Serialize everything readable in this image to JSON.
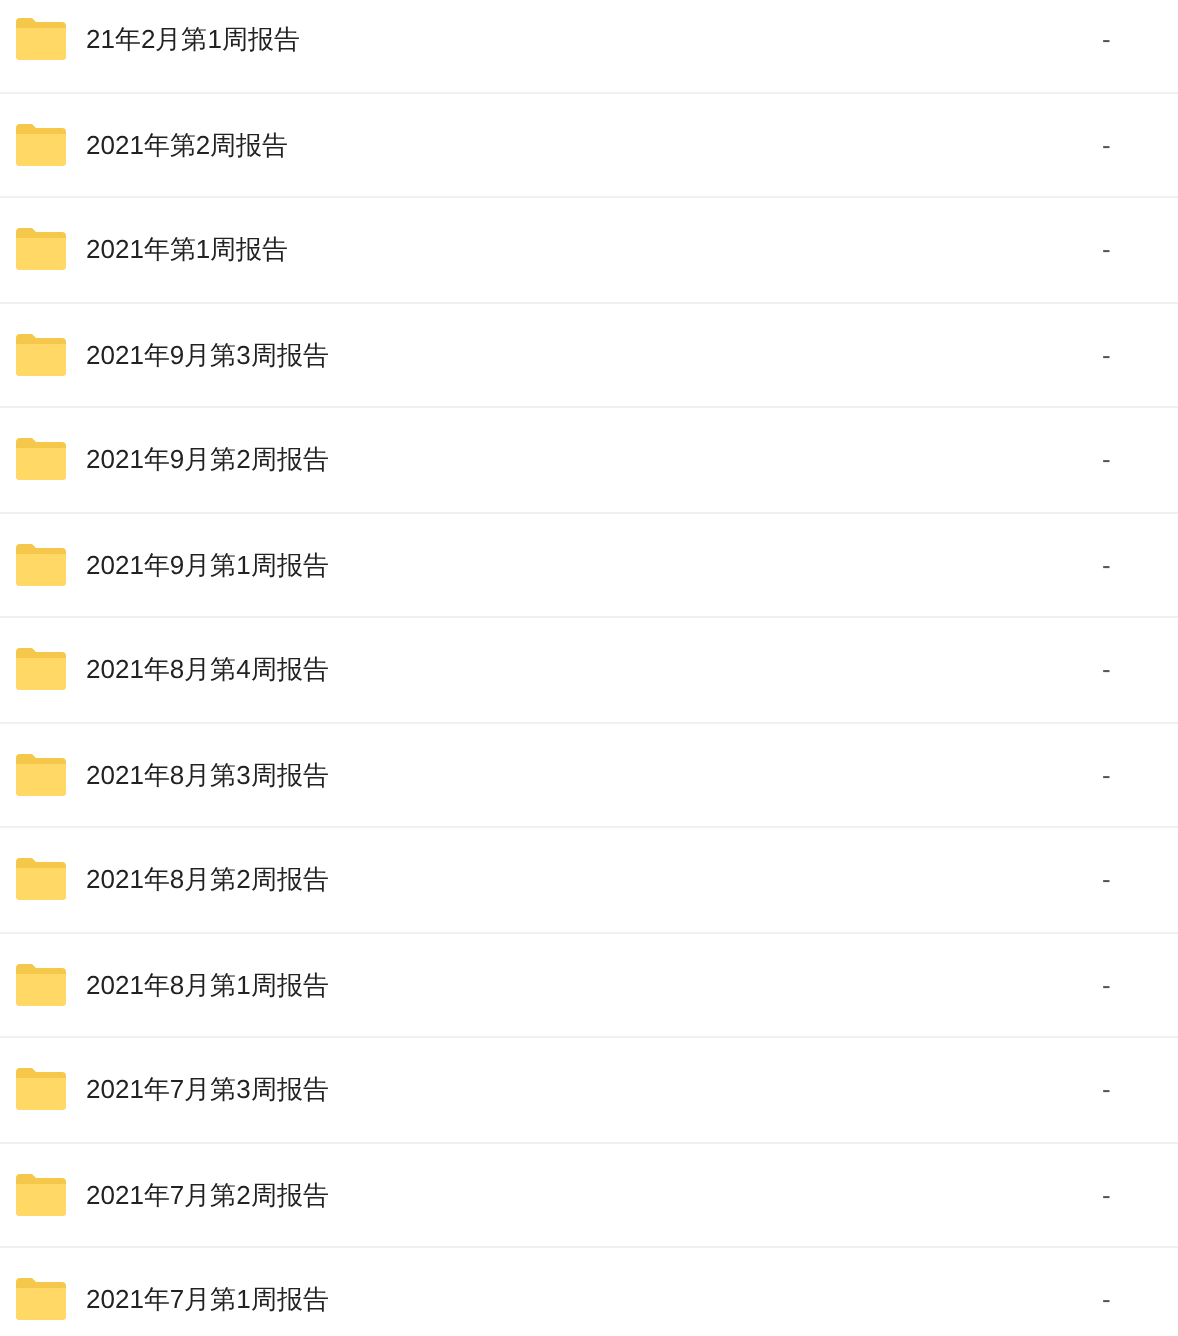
{
  "files": [
    {
      "name": "21年2月第1周报告",
      "size": "-"
    },
    {
      "name": "2021年第2周报告",
      "size": "-"
    },
    {
      "name": "2021年第1周报告",
      "size": "-"
    },
    {
      "name": "2021年9月第3周报告",
      "size": "-"
    },
    {
      "name": "2021年9月第2周报告",
      "size": "-"
    },
    {
      "name": "2021年9月第1周报告",
      "size": "-"
    },
    {
      "name": "2021年8月第4周报告",
      "size": "-"
    },
    {
      "name": "2021年8月第3周报告",
      "size": "-"
    },
    {
      "name": "2021年8月第2周报告",
      "size": "-"
    },
    {
      "name": "2021年8月第1周报告",
      "size": "-"
    },
    {
      "name": "2021年7月第3周报告",
      "size": "-"
    },
    {
      "name": "2021年7月第2周报告",
      "size": "-"
    },
    {
      "name": "2021年7月第1周报告",
      "size": "-"
    }
  ]
}
